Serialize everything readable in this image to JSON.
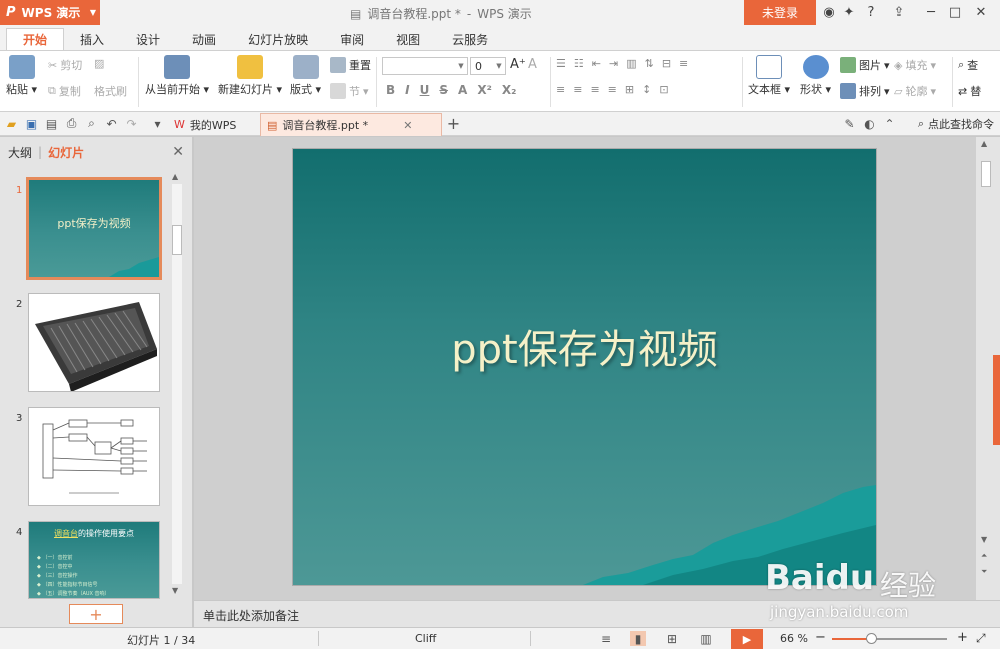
{
  "app": {
    "name": "WPS 演示",
    "logo": "P"
  },
  "title": {
    "doc": "调音台教程.ppt *",
    "sep": "-",
    "app": "WPS 演示"
  },
  "login": "未登录",
  "ribbon_tabs": [
    "开始",
    "插入",
    "设计",
    "动画",
    "幻灯片放映",
    "审阅",
    "视图",
    "云服务"
  ],
  "ribbon": {
    "paste": "粘贴",
    "cut": "剪切",
    "copy": "复制",
    "format_painter": "格式刷",
    "from_current": "从当前开始",
    "new_slide": "新建幻灯片",
    "layout": "版式",
    "reset": "重置",
    "section": "节",
    "font_size": "0",
    "textbox": "文本框",
    "shape": "形状",
    "picture": "图片",
    "fill": "填充",
    "arrange": "排列",
    "outline": "轮廓",
    "find": "查",
    "replace": "替"
  },
  "doc_tabs": {
    "mywps": "我的WPS",
    "current": "调音台教程.ppt *"
  },
  "find_command": "点此查找命令",
  "left_panel": {
    "outline": "大纲",
    "slides": "幻灯片"
  },
  "thumbnails": [
    {
      "num": "1",
      "title": "ppt保存为视频"
    },
    {
      "num": "2"
    },
    {
      "num": "3"
    },
    {
      "num": "4",
      "title_hl": "调音台",
      "title_rest": "的操作使用要点",
      "bullets": [
        "（一）音控前",
        "（二）音控中",
        "（三）音控操作",
        "（四）性能指标节目信号",
        "（五）调整节奏（AUX 音响）"
      ]
    }
  ],
  "slide": {
    "title": "ppt保存为视频"
  },
  "notes_placeholder": "单击此处添加备注",
  "status": {
    "slide_info": "幻灯片 1 / 34",
    "theme": "Cliff",
    "zoom": "66 %",
    "zoom_fraction": 0.35
  },
  "watermark": {
    "baidu": "Baidu",
    "jingyan": "经验",
    "url": "jingyan.baidu.com"
  }
}
